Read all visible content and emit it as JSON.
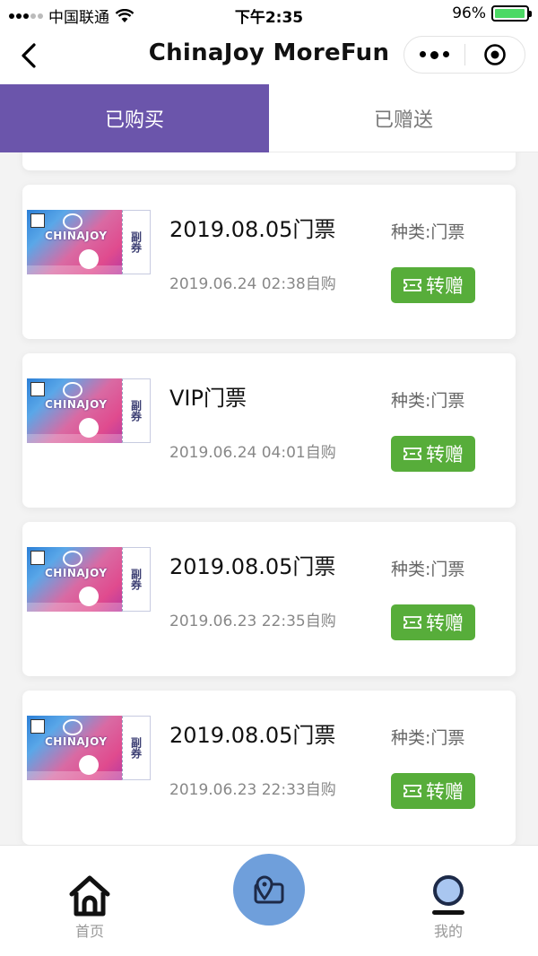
{
  "status_bar": {
    "carrier": "中国联通",
    "time": "下午2:35",
    "battery": "96%",
    "battery_level": 0.96
  },
  "nav": {
    "title": "ChinaJoy MoreFun"
  },
  "tabs": [
    {
      "label": "已购买",
      "active": true
    },
    {
      "label": "已赠送",
      "active": false
    }
  ],
  "tickets": [
    {
      "title": "2019.08.05门票",
      "purchase": "2019.06.24 02:38自购",
      "kind": "种类:门票",
      "action": "转赠",
      "art_text": "CHINAJOY",
      "stub_text": "副券"
    },
    {
      "title": "VIP门票",
      "purchase": "2019.06.24 04:01自购",
      "kind": "种类:门票",
      "action": "转赠",
      "art_text": "CHINAJOY",
      "stub_text": "副券"
    },
    {
      "title": "2019.08.05门票",
      "purchase": "2019.06.23 22:35自购",
      "kind": "种类:门票",
      "action": "转赠",
      "art_text": "CHINAJOY",
      "stub_text": "副券"
    },
    {
      "title": "2019.08.05门票",
      "purchase": "2019.06.23 22:33自购",
      "kind": "种类:门票",
      "action": "转赠",
      "art_text": "CHINAJOY",
      "stub_text": "副券"
    }
  ],
  "tabbar": {
    "home": "首页",
    "mine": "我的"
  },
  "colors": {
    "tab_active": "#6b55ab",
    "button_green": "#57ad3a",
    "center_button": "#6f9fdb"
  }
}
